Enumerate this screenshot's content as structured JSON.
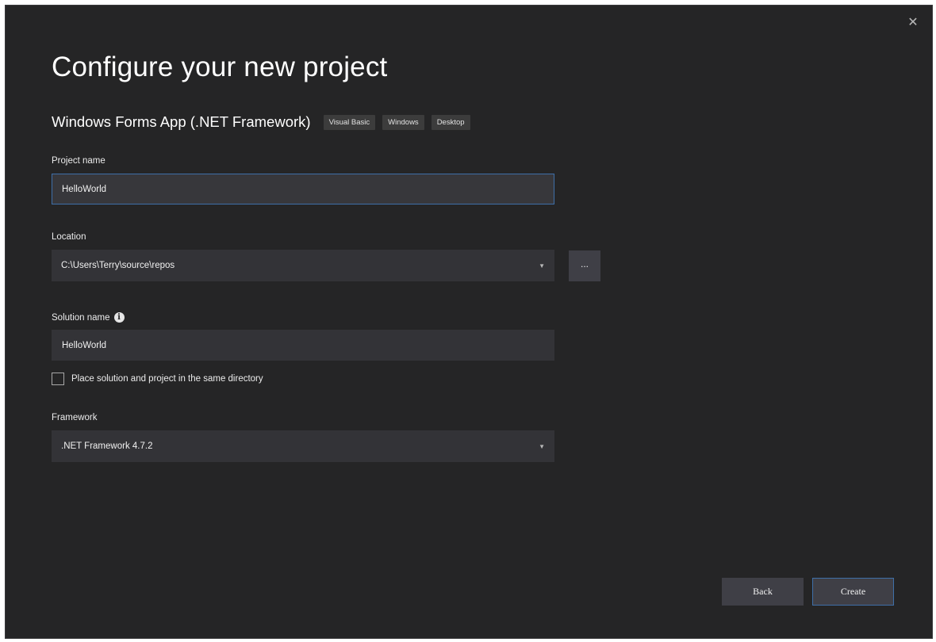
{
  "dialog": {
    "close_glyph": "✕",
    "title": "Configure your new project"
  },
  "template": {
    "name": "Windows Forms App (.NET Framework)",
    "tags": [
      "Visual Basic",
      "Windows",
      "Desktop"
    ]
  },
  "fields": {
    "project_name": {
      "label": "Project name",
      "value": "HelloWorld"
    },
    "location": {
      "label": "Location",
      "value": "C:\\Users\\Terry\\source\\repos",
      "browse_label": "..."
    },
    "solution_name": {
      "label": "Solution name",
      "info_glyph": "i",
      "value": "HelloWorld"
    },
    "same_directory": {
      "label": "Place solution and project in the same directory",
      "checked": false
    },
    "framework": {
      "label": "Framework",
      "value": ".NET Framework 4.7.2"
    }
  },
  "icons": {
    "close": "close-icon",
    "info": "info-icon",
    "dropdown": "chevron-down-icon"
  },
  "buttons": {
    "back": "Back",
    "create": "Create"
  },
  "colors": {
    "background": "#252526",
    "input": "#333337",
    "button": "#3f3f46",
    "focus_border": "#3e6fa8"
  }
}
